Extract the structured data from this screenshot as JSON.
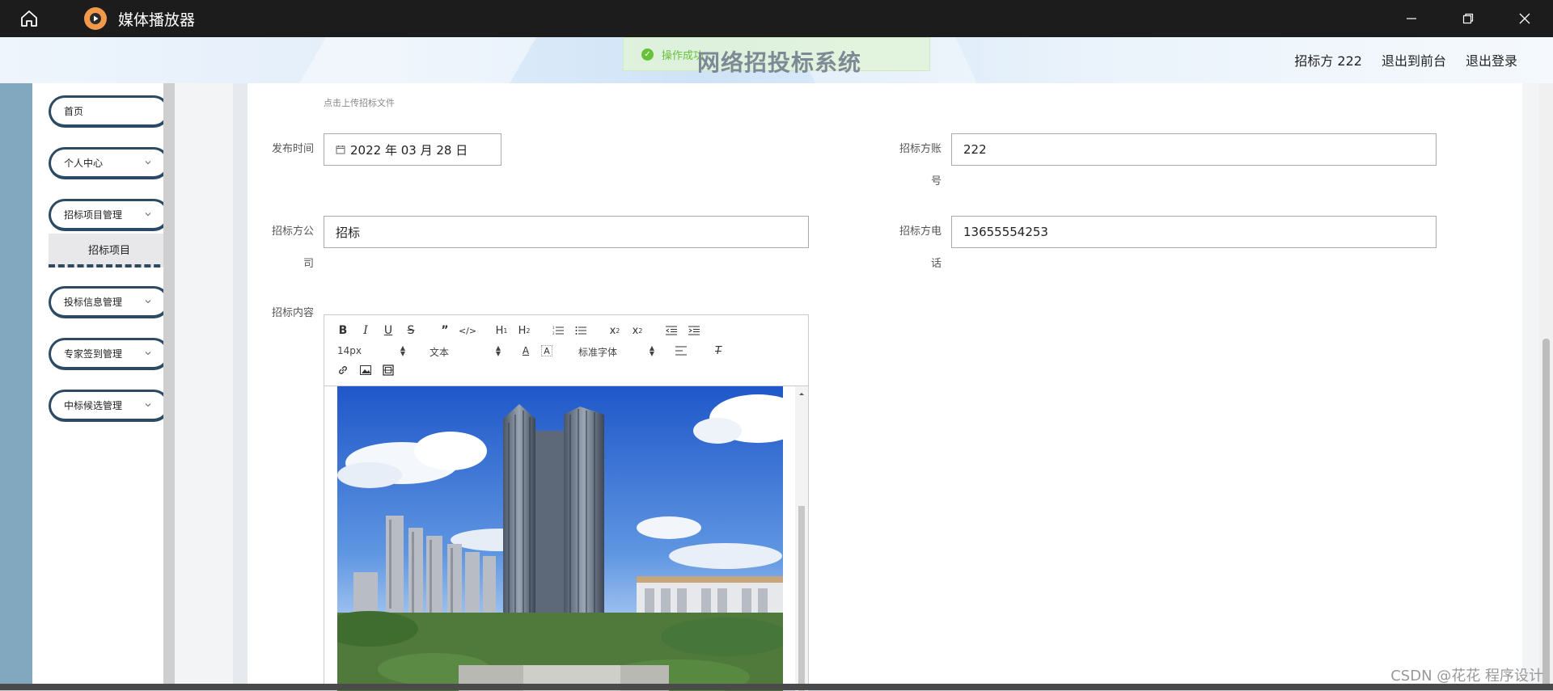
{
  "window": {
    "title": "媒体播放器"
  },
  "header": {
    "site_title": "网络招投标系统",
    "toast": "操作成功",
    "user": "招标方 222",
    "back_front": "退出到前台",
    "logout": "退出登录"
  },
  "sidebar": {
    "items": [
      {
        "label": "首页"
      },
      {
        "label": "个人中心"
      },
      {
        "label": "招标项目管理"
      },
      {
        "label": "投标信息管理"
      },
      {
        "label": "专家签到管理"
      },
      {
        "label": "中标候选管理"
      }
    ],
    "sub_item": "招标项目"
  },
  "form": {
    "upload_tip": "点击上传招标文件",
    "publish_time_label": "发布时间",
    "publish_time_value": "2022 年 03 月 28 日",
    "account_label_1": "招标方账",
    "account_label_2": "号",
    "account_value": "222",
    "company_label_1": "招标方公",
    "company_label_2": "司",
    "company_value": "招标",
    "phone_label_1": "招标方电",
    "phone_label_2": "话",
    "phone_value": "13655554253",
    "content_label": "招标内容"
  },
  "editor": {
    "font_size": "14px",
    "paragraph": "文本",
    "font_family": "标准字体"
  },
  "footer": {
    "watermark": "CSDN @花花 程序设计"
  }
}
